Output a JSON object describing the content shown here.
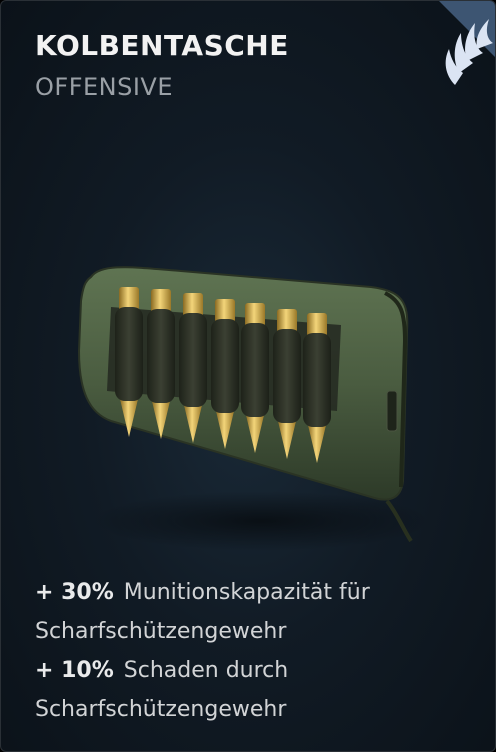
{
  "card": {
    "title": "KOLBENTASCHE",
    "category": "OFFENSIVE",
    "corner_icon": "wing-icon",
    "item_image": "buttstock-ammo-pouch",
    "stats": [
      {
        "value": "+ 30%",
        "text_line1": "Munitionskapazität für",
        "text_line2": "Scharfschützengewehr"
      },
      {
        "value": "+ 10%",
        "text_line1": "Schaden durch",
        "text_line2": "Scharfschützengewehr"
      }
    ]
  }
}
